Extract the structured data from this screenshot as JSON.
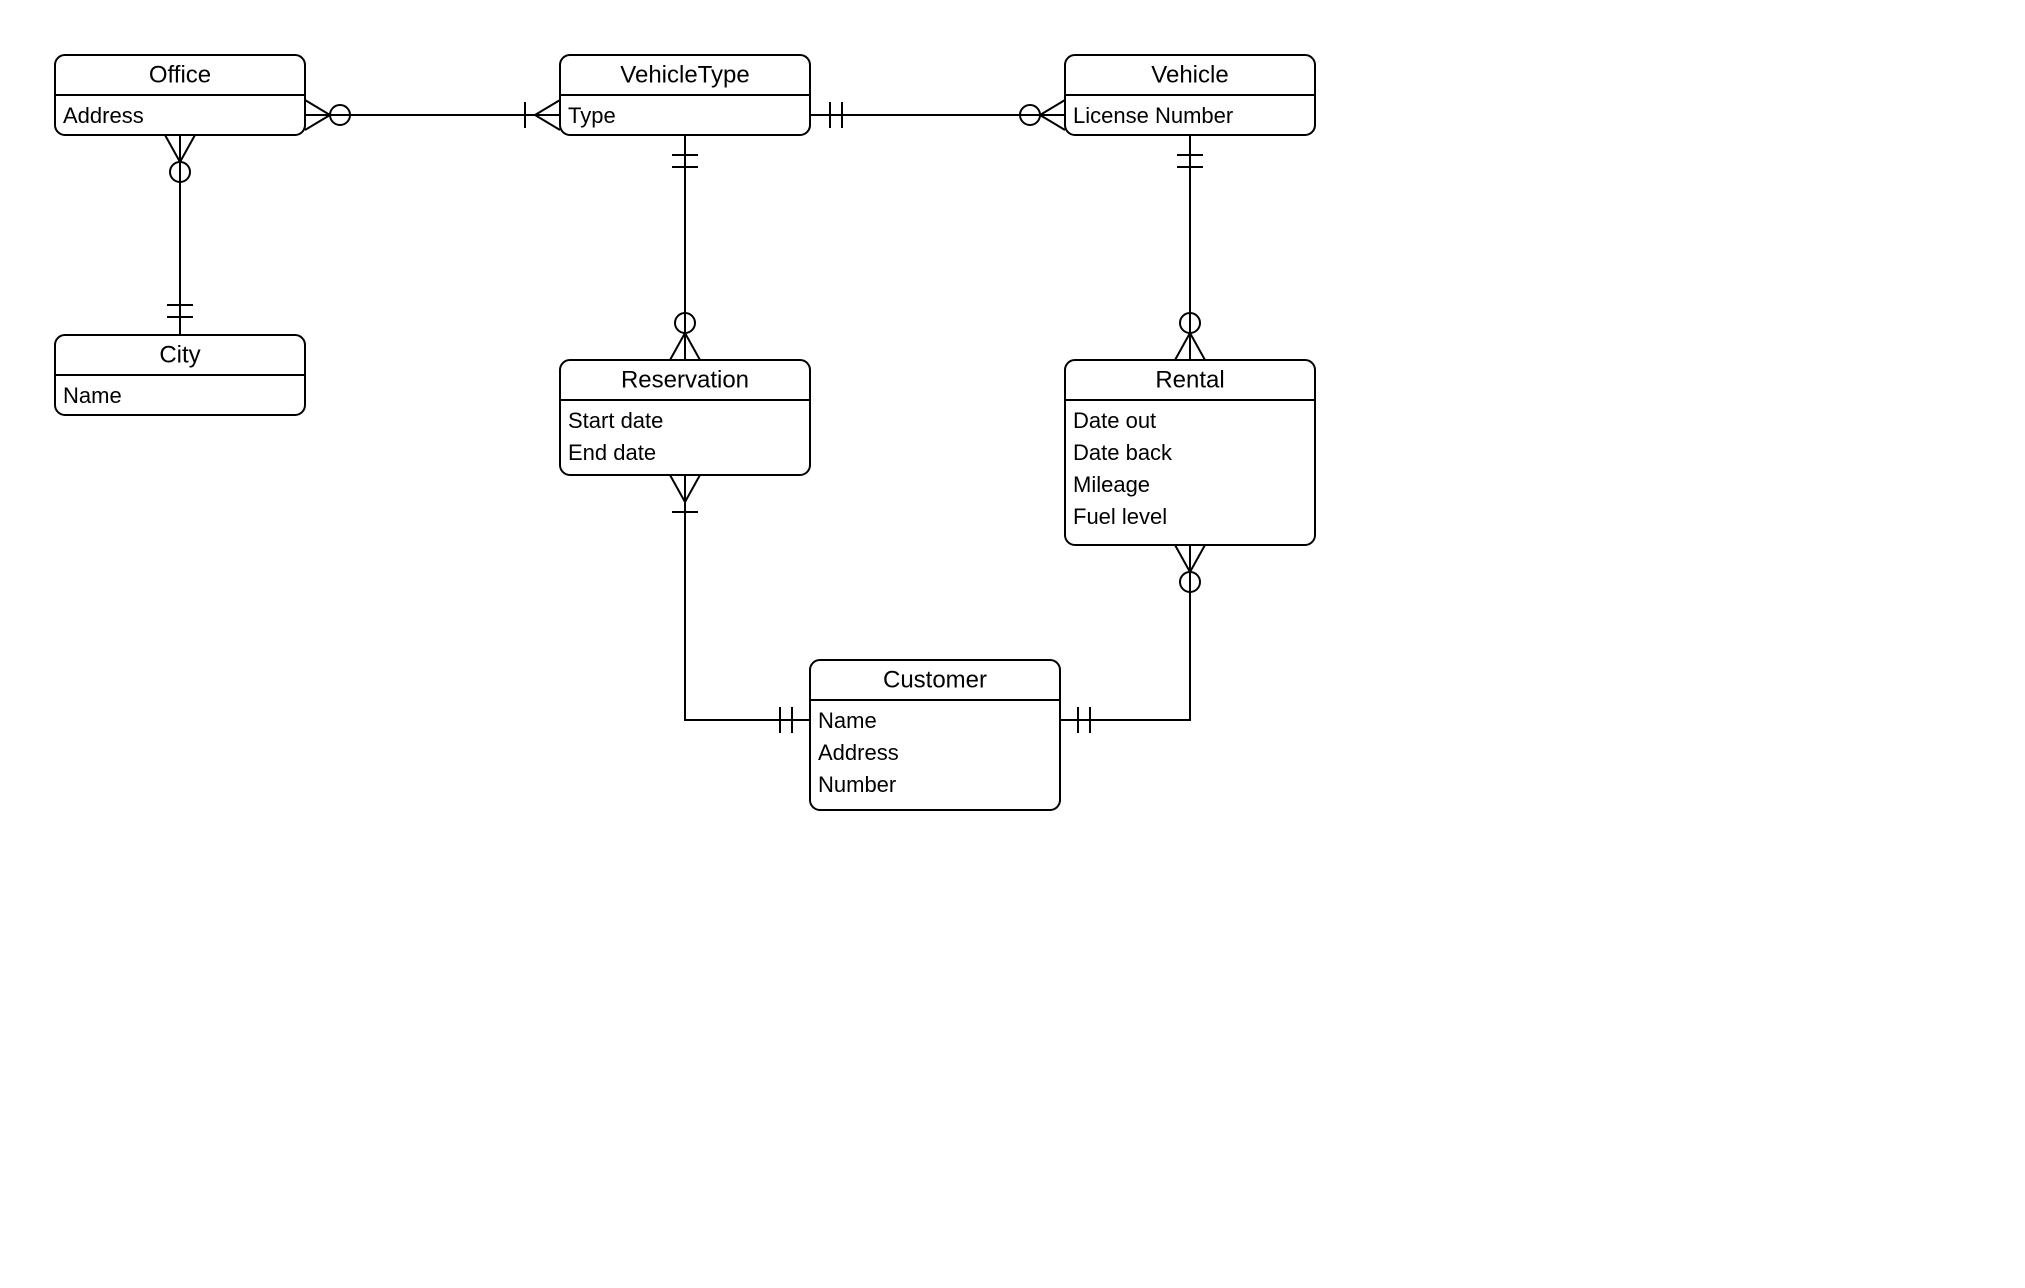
{
  "entities": {
    "office": {
      "title": "Office",
      "attrs": [
        "Address"
      ]
    },
    "city": {
      "title": "City",
      "attrs": [
        "Name"
      ]
    },
    "vehicleType": {
      "title": "VehicleType",
      "attrs": [
        "Type"
      ]
    },
    "vehicle": {
      "title": "Vehicle",
      "attrs": [
        "License Number"
      ]
    },
    "reservation": {
      "title": "Reservation",
      "attrs": [
        "Start date",
        "End date"
      ]
    },
    "rental": {
      "title": "Rental",
      "attrs": [
        "Date out",
        "Date back",
        "Mileage",
        "Fuel level"
      ]
    },
    "customer": {
      "title": "Customer",
      "attrs": [
        "Name",
        "Address",
        "Number"
      ]
    }
  },
  "relationships": [
    {
      "from": "Office",
      "to": "City",
      "fromCard": "zero-or-many",
      "toCard": "one-and-only-one"
    },
    {
      "from": "Office",
      "to": "VehicleType",
      "fromCard": "zero-or-many",
      "toCard": "one-or-many"
    },
    {
      "from": "VehicleType",
      "to": "Vehicle",
      "fromCard": "one-and-only-one",
      "toCard": "zero-or-many"
    },
    {
      "from": "VehicleType",
      "to": "Reservation",
      "fromCard": "one-and-only-one",
      "toCard": "zero-or-many"
    },
    {
      "from": "Vehicle",
      "to": "Rental",
      "fromCard": "one-and-only-one",
      "toCard": "zero-or-many"
    },
    {
      "from": "Reservation",
      "to": "Customer",
      "fromCard": "one-or-many",
      "toCard": "one-and-only-one"
    },
    {
      "from": "Rental",
      "to": "Customer",
      "fromCard": "zero-or-many",
      "toCard": "one-and-only-one"
    }
  ]
}
